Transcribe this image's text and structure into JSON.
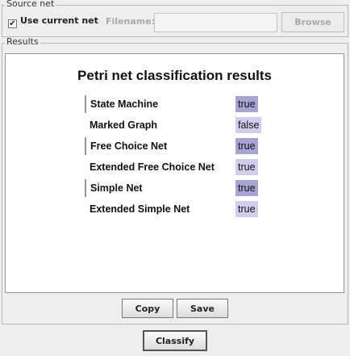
{
  "source": {
    "title": "Source net",
    "use_current_label": "Use current net",
    "use_current_checked": true,
    "filename_label": "Filename:",
    "filename_value": "",
    "browse_label": "Browse"
  },
  "results": {
    "title": "Results",
    "heading": "Petri net classification results",
    "rows": [
      {
        "name": "State Machine",
        "value": "true"
      },
      {
        "name": "Marked Graph",
        "value": "false"
      },
      {
        "name": "Free Choice Net",
        "value": "true"
      },
      {
        "name": "Extended Free Choice Net",
        "value": "true"
      },
      {
        "name": "Simple Net",
        "value": "true"
      },
      {
        "name": "Extended Simple Net",
        "value": "true"
      }
    ],
    "copy_label": "Copy",
    "save_label": "Save"
  },
  "classify_label": "Classify",
  "colors": {
    "highlight_dark": "#a7a3d4",
    "highlight_light": "#d0cdee"
  }
}
